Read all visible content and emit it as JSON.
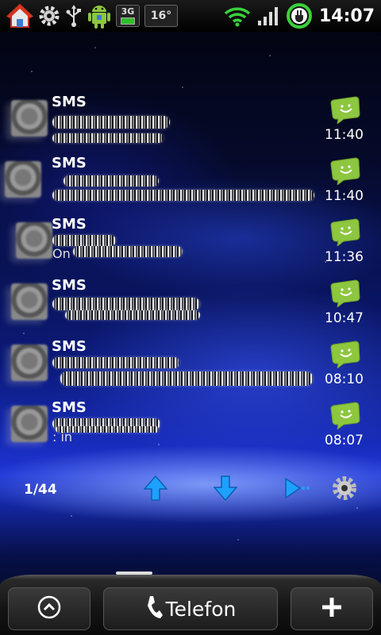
{
  "status_bar": {
    "icons_left": [
      "home-icon",
      "gear-icon",
      "usb-icon",
      "android-icon"
    ],
    "network_badge": "3G",
    "temperature": "16°",
    "icons_right": [
      "wifi-icon",
      "signal-icon",
      "battery-charging-icon"
    ],
    "time": "14:07"
  },
  "messages": [
    {
      "title": "SMS",
      "time": "11:40",
      "snippet": ""
    },
    {
      "title": "SMS",
      "time": "11:40",
      "snippet": ""
    },
    {
      "title": "SMS",
      "time": "11:36",
      "snippet": "On"
    },
    {
      "title": "SMS",
      "time": "10:47",
      "snippet": ""
    },
    {
      "title": "SMS",
      "time": "08:10",
      "snippet": ""
    },
    {
      "title": "SMS",
      "time": "08:07",
      "snippet": ": in"
    }
  ],
  "controls": {
    "counter": "1/44"
  },
  "dock": {
    "phone_label": "Telefon"
  },
  "colors": {
    "sms_icon_green": "#8dc63f",
    "arrow_blue": "#1ea0ff"
  }
}
